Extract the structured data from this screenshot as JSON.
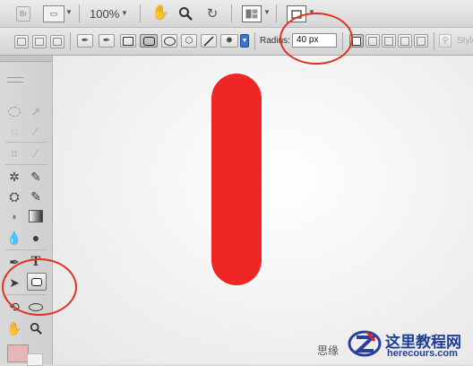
{
  "app_bar": {
    "zoom": "100%",
    "icons": [
      "br-icon",
      "view-extras-icon",
      "hand-icon",
      "zoom-icon",
      "rotate-view-icon",
      "arrange-documents-icon",
      "screen-mode-icon"
    ]
  },
  "options_bar": {
    "radius_label": "Radius:",
    "radius_value": "40 px",
    "style_label": "Style"
  },
  "colors": {
    "shape_fill": "#ee2626",
    "annotation": "#e0321f",
    "foreground_swatch": "#e8b4b4"
  },
  "watermark": {
    "partial_text": "思缘",
    "brand_text": "这里教程网",
    "url_text": "herecours.com"
  }
}
